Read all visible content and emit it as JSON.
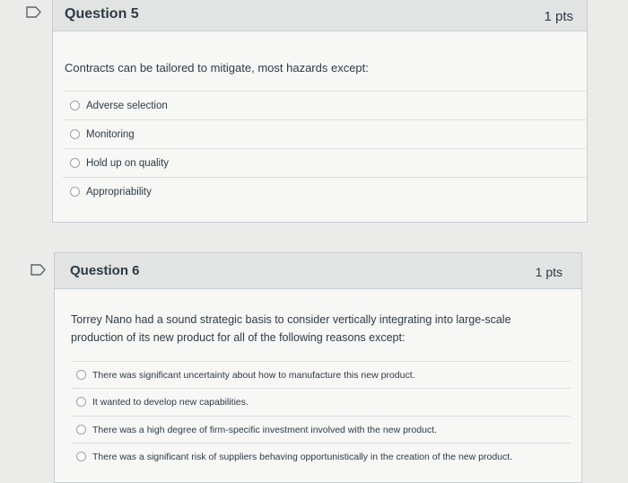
{
  "questions": [
    {
      "title": "Question 5",
      "points": "1 pts",
      "text": "Contracts can be tailored to mitigate, most hazards except:",
      "answers": [
        "Adverse selection",
        "Monitoring",
        "Hold up on quality",
        "Appropriability"
      ]
    },
    {
      "title": "Question 6",
      "points": "1 pts",
      "text_line1": "Torrey Nano had a sound strategic basis to consider vertically integrating into large-scale",
      "text_line2": "production of its new product for all of the following reasons except:",
      "answers": [
        "There was significant uncertainty about how to manufacture this new product.",
        "It wanted to develop new capabilities.",
        "There was a high degree of firm-specific investment involved with the new product.",
        "There was a significant risk of suppliers behaving opportunistically in the creation of the new product."
      ]
    }
  ],
  "icons": {
    "flag": "flag-outline-icon",
    "radio": "radio-unchecked-icon"
  },
  "colors": {
    "background": "#ebebea",
    "header": "#e2e3e3",
    "border": "#c7cdd1",
    "text": "#2d3b45"
  }
}
